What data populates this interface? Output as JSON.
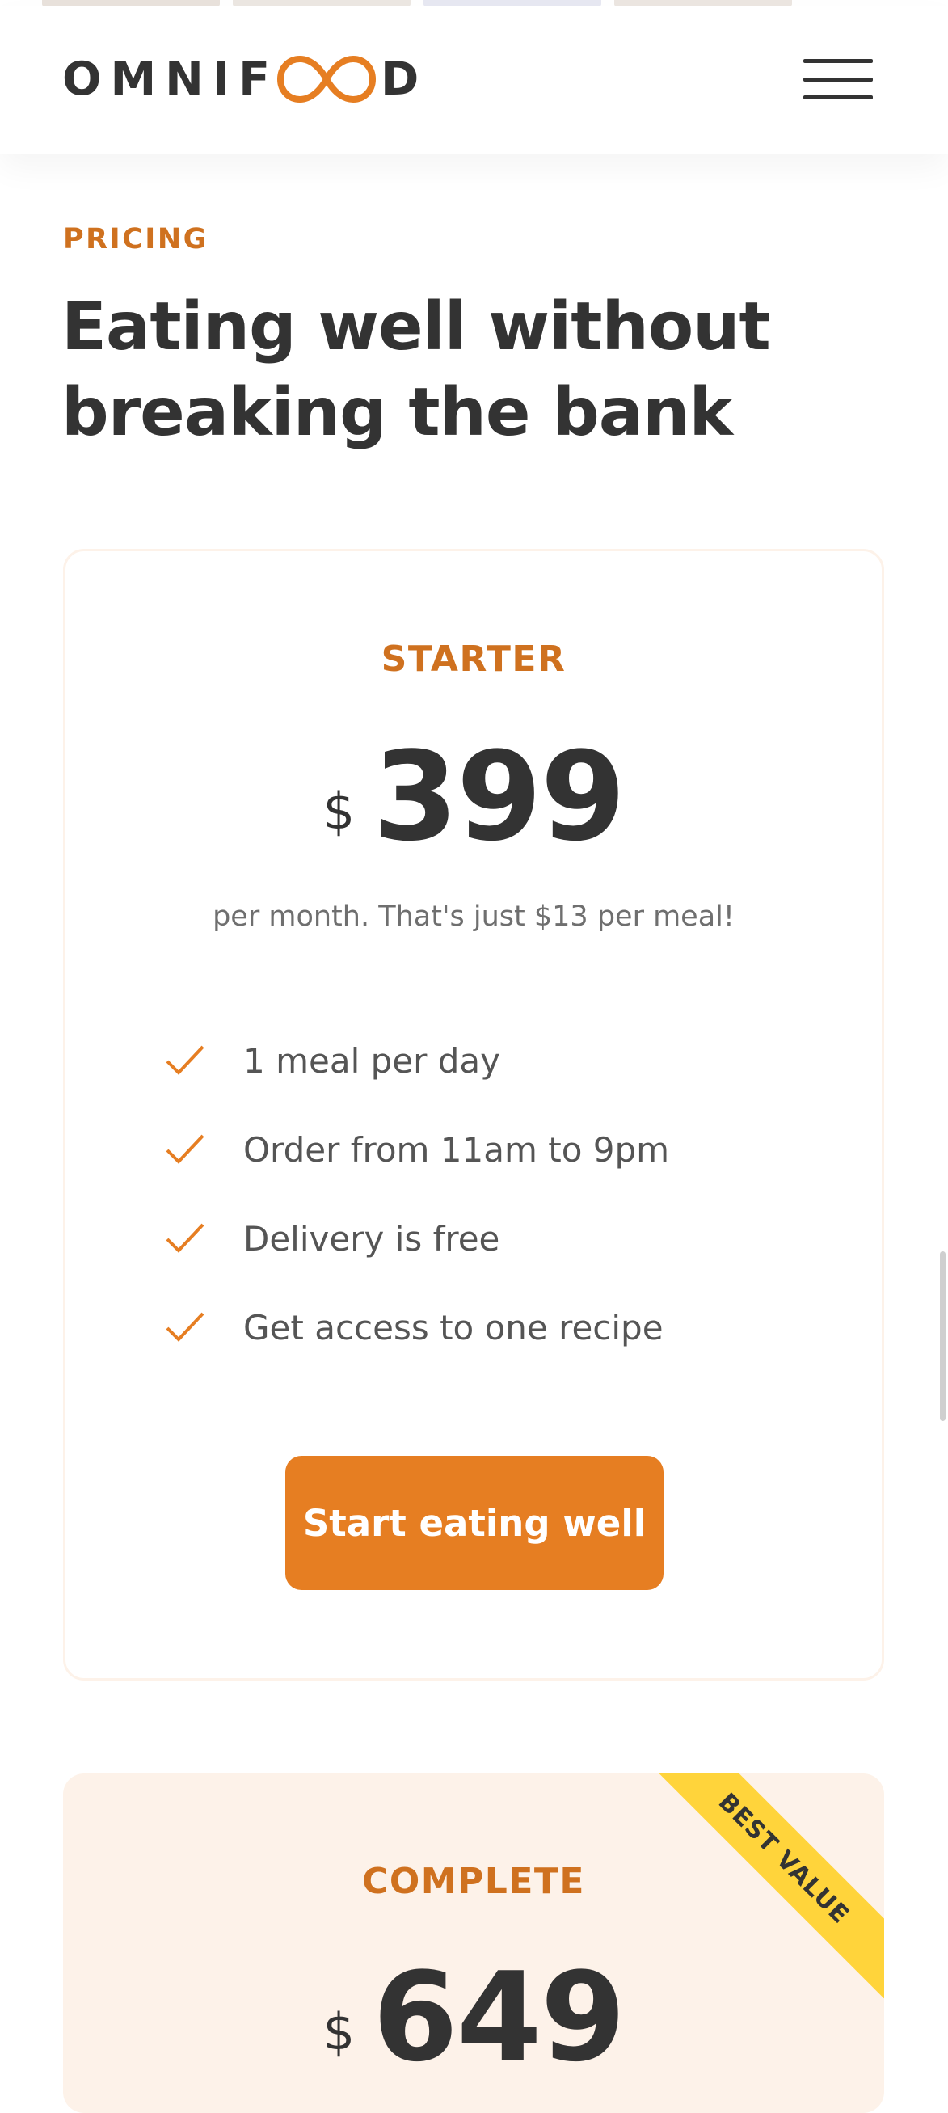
{
  "header": {
    "logo_left": "OMNIF",
    "logo_right": "D",
    "logo_alt": "OMNIFOOD"
  },
  "colors": {
    "accent": "#e67e22",
    "accent_dark": "#cf711f",
    "tint": "#fdf2e9",
    "badge": "#ffd43b",
    "text": "#333333"
  },
  "section": {
    "subheading": "PRICING",
    "heading": "Eating well without breaking the bank"
  },
  "plans": [
    {
      "name": "STARTER",
      "currency": "$",
      "price": "399",
      "note": "per month. That's just $13 per meal!",
      "features": [
        "1 meal per day",
        "Order from 11am to 9pm",
        "Delivery is free",
        "Get access to one recipe"
      ],
      "cta": "Start eating well"
    },
    {
      "name": "COMPLETE",
      "currency": "$",
      "price": "649",
      "badge": "BEST VALUE"
    }
  ],
  "icons": {
    "feature": "checkmark-icon",
    "menu": "hamburger-menu-icon",
    "logo_mark": "infinity-logo-icon"
  }
}
